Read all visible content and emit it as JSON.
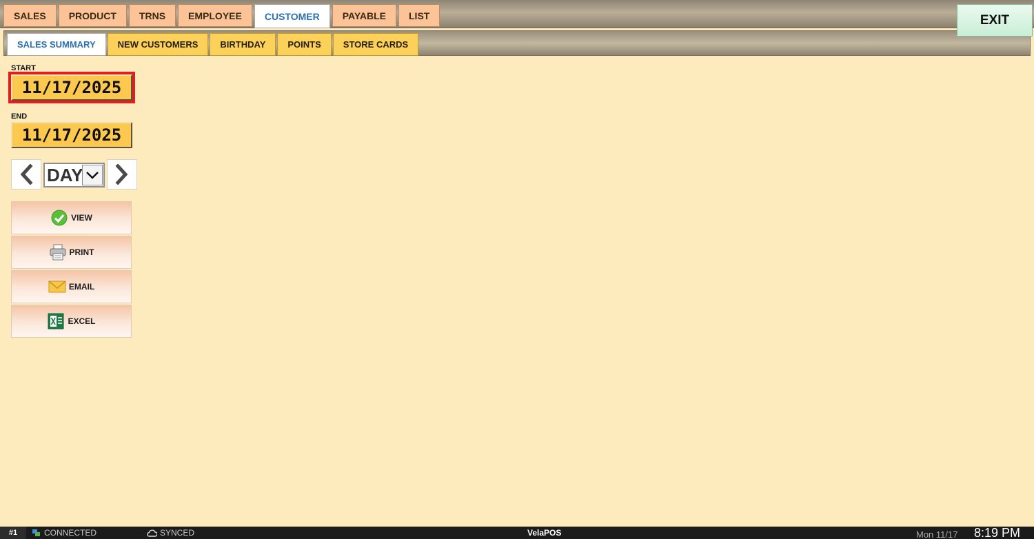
{
  "main_tabs": [
    {
      "label": "SALES",
      "active": false
    },
    {
      "label": "PRODUCT",
      "active": false
    },
    {
      "label": "TRNS",
      "active": false
    },
    {
      "label": "EMPLOYEE",
      "active": false
    },
    {
      "label": "CUSTOMER",
      "active": true
    },
    {
      "label": "PAYABLE",
      "active": false
    },
    {
      "label": "LIST",
      "active": false
    }
  ],
  "exit_label": "EXIT",
  "sub_tabs": [
    {
      "label": "SALES SUMMARY",
      "active": true
    },
    {
      "label": "NEW CUSTOMERS",
      "active": false
    },
    {
      "label": "BIRTHDAY",
      "active": false
    },
    {
      "label": "POINTS",
      "active": false
    },
    {
      "label": "STORE CARDS",
      "active": false
    }
  ],
  "range": {
    "start_label": "START",
    "start_value": "11/17/2025",
    "end_label": "END",
    "end_value": "11/17/2025",
    "period_value": "DAY"
  },
  "actions": {
    "view": "VIEW",
    "print": "PRINT",
    "email": "EMAIL",
    "excel": "EXCEL"
  },
  "status": {
    "station": "#1",
    "connection": "CONNECTED",
    "sync": "SYNCED",
    "brand_prefix": "Vela",
    "brand_suffix": "POS",
    "date": "Mon 11/17",
    "time": "8:19 PM"
  },
  "colors": {
    "background": "#fdebbe",
    "main_tab": "#fbc396",
    "sub_tab": "#fcd15a",
    "active_tab_text": "#2a6fb0",
    "date_field": "#fcc84e",
    "focus_outline": "#e02020",
    "exit": "#d4f3df"
  }
}
